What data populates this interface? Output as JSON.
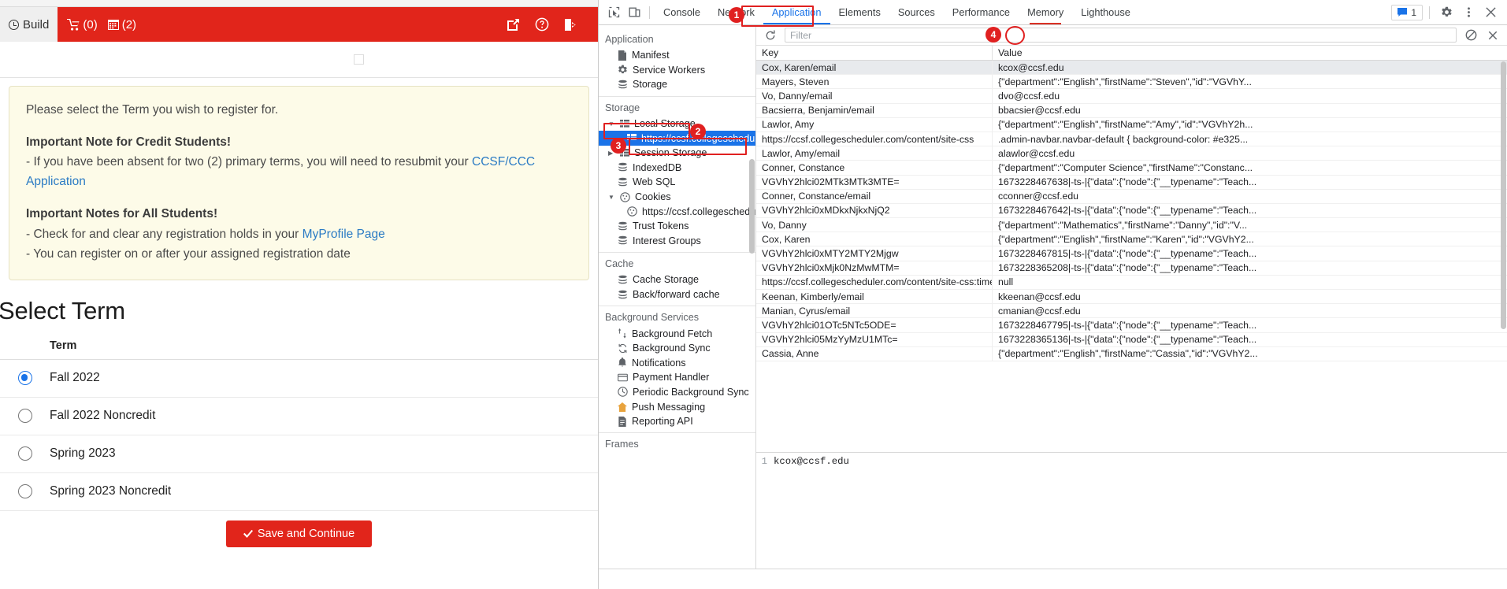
{
  "webpage": {
    "navbar": {
      "build_label": "Build",
      "cart_count": "(0)",
      "calendar_count": "(2)",
      "icons": [
        "external-link-icon",
        "help-icon",
        "logout-icon"
      ]
    },
    "notice": {
      "line1": "Please select the Term you wish to register for.",
      "heading1": "Important Note for Credit Students!",
      "line2_pre": "- If you have been absent for two (2) primary terms, you will need to resubmit your ",
      "line2_link": "CCSF/CCC Application",
      "heading2": "Important Notes for All Students!",
      "line3_pre": "- Check for and clear any registration holds in your ",
      "line3_link": "MyProfile Page",
      "line4": "- You can register on or after your assigned registration date"
    },
    "select_term": {
      "title": "Select Term",
      "column_header": "Term",
      "options": [
        {
          "label": "Fall 2022",
          "selected": true
        },
        {
          "label": "Fall 2022 Noncredit",
          "selected": false
        },
        {
          "label": "Spring 2023",
          "selected": false
        },
        {
          "label": "Spring 2023 Noncredit",
          "selected": false
        }
      ],
      "save_button": "Save and Continue"
    }
  },
  "devtools": {
    "tabs": [
      {
        "label": "Console",
        "active": false
      },
      {
        "label": "Network",
        "active": false
      },
      {
        "label": "Application",
        "active": true
      },
      {
        "label": "Elements",
        "active": false
      },
      {
        "label": "Sources",
        "active": false
      },
      {
        "label": "Performance",
        "active": false
      },
      {
        "label": "Memory",
        "active": false
      },
      {
        "label": "Lighthouse",
        "active": false
      }
    ],
    "message_count": "1",
    "sidebar": {
      "application_section": "Application",
      "application_items": [
        {
          "label": "Manifest",
          "icon": "manifest-icon"
        },
        {
          "label": "Service Workers",
          "icon": "gear-icon"
        },
        {
          "label": "Storage",
          "icon": "database-icon"
        }
      ],
      "storage_section": "Storage",
      "storage_items": [
        {
          "label": "Local Storage",
          "icon": "table-icon",
          "level": 1,
          "expanded": true
        },
        {
          "label": "https://ccsf.collegescheduler",
          "icon": "table-icon",
          "level": 2,
          "selected": true
        },
        {
          "label": "Session Storage",
          "icon": "table-icon",
          "level": 1,
          "expanded": false
        },
        {
          "label": "IndexedDB",
          "icon": "database-icon",
          "level": 1
        },
        {
          "label": "Web SQL",
          "icon": "database-icon",
          "level": 1
        },
        {
          "label": "Cookies",
          "icon": "cookie-icon",
          "level": 1,
          "expanded": true
        },
        {
          "label": "https://ccsf.collegescheduler",
          "icon": "cookie-icon",
          "level": 2
        },
        {
          "label": "Trust Tokens",
          "icon": "database-icon",
          "level": 1
        },
        {
          "label": "Interest Groups",
          "icon": "database-icon",
          "level": 1
        }
      ],
      "cache_section": "Cache",
      "cache_items": [
        {
          "label": "Cache Storage",
          "icon": "database-icon"
        },
        {
          "label": "Back/forward cache",
          "icon": "database-icon"
        }
      ],
      "background_section": "Background Services",
      "background_items": [
        {
          "label": "Background Fetch",
          "icon": "fetch-icon"
        },
        {
          "label": "Background Sync",
          "icon": "sync-icon"
        },
        {
          "label": "Notifications",
          "icon": "bell-icon"
        },
        {
          "label": "Payment Handler",
          "icon": "payment-icon"
        },
        {
          "label": "Periodic Background Sync",
          "icon": "clock-icon"
        },
        {
          "label": "Push Messaging",
          "icon": "push-icon"
        },
        {
          "label": "Reporting API",
          "icon": "report-icon"
        }
      ],
      "frames_section": "Frames"
    },
    "toolbar": {
      "refresh_icon": "refresh-icon",
      "filter_placeholder": "Filter",
      "clear_icon": "no-entry-icon",
      "close_icon": "close-icon"
    },
    "table": {
      "columns": [
        "Key",
        "Value"
      ],
      "rows": [
        {
          "key": "Cox, Karen/email",
          "value": "kcox@ccsf.edu",
          "selected": true
        },
        {
          "key": "Mayers, Steven",
          "value": "{\"department\":\"English\",\"firstName\":\"Steven\",\"id\":\"VGVhY..."
        },
        {
          "key": "Vo, Danny/email",
          "value": "dvo@ccsf.edu"
        },
        {
          "key": "Bacsierra, Benjamin/email",
          "value": "bbacsier@ccsf.edu"
        },
        {
          "key": "Lawlor, Amy",
          "value": "{\"department\":\"English\",\"firstName\":\"Amy\",\"id\":\"VGVhY2h..."
        },
        {
          "key": "https://ccsf.collegescheduler.com/content/site-css",
          "value": ".admin-navbar.navbar-default { background-color: #e325..."
        },
        {
          "key": "Lawlor, Amy/email",
          "value": "alawlor@ccsf.edu"
        },
        {
          "key": "Conner, Constance",
          "value": "{\"department\":\"Computer Science\",\"firstName\":\"Constanc..."
        },
        {
          "key": "VGVhY2hlci02MTk3MTk3MTE=",
          "value": "1673228467638|-ts-|{\"data\":{\"node\":{\"__typename\":\"Teach..."
        },
        {
          "key": "Conner, Constance/email",
          "value": "cconner@ccsf.edu"
        },
        {
          "key": "VGVhY2hlci0xMDkxNjkxNjQ2",
          "value": "1673228467642|-ts-|{\"data\":{\"node\":{\"__typename\":\"Teach..."
        },
        {
          "key": "Vo, Danny",
          "value": "{\"department\":\"Mathematics\",\"firstName\":\"Danny\",\"id\":\"V..."
        },
        {
          "key": "Cox, Karen",
          "value": "{\"department\":\"English\",\"firstName\":\"Karen\",\"id\":\"VGVhY2..."
        },
        {
          "key": "VGVhY2hlci0xMTY2MTY2Mjgw",
          "value": "1673228467815|-ts-|{\"data\":{\"node\":{\"__typename\":\"Teach..."
        },
        {
          "key": "VGVhY2hlci0xMjk0NzMwMTM=",
          "value": "1673228365208|-ts-|{\"data\":{\"node\":{\"__typename\":\"Teach..."
        },
        {
          "key": "https://ccsf.collegescheduler.com/content/site-css:timest...",
          "value": "null"
        },
        {
          "key": "Keenan, Kimberly/email",
          "value": "kkeenan@ccsf.edu"
        },
        {
          "key": "Manian, Cyrus/email",
          "value": "cmanian@ccsf.edu"
        },
        {
          "key": "VGVhY2hlci01OTc5NTc5ODE=",
          "value": "1673228467795|-ts-|{\"data\":{\"node\":{\"__typename\":\"Teach..."
        },
        {
          "key": "VGVhY2hlci05MzYyMzU1MTc=",
          "value": "1673228365136|-ts-|{\"data\":{\"node\":{\"__typename\":\"Teach..."
        },
        {
          "key": "Cassia, Anne",
          "value": "{\"department\":\"English\",\"firstName\":\"Cassia\",\"id\":\"VGVhY2..."
        }
      ]
    },
    "preview": {
      "line_number": "1",
      "content": "kcox@ccsf.edu"
    }
  },
  "annotations": [
    {
      "n": "1",
      "target": "network-tab"
    },
    {
      "n": "2",
      "target": "local-storage-item"
    },
    {
      "n": "3",
      "target": "origin-item"
    },
    {
      "n": "4",
      "target": "clear-button"
    }
  ],
  "colors": {
    "brand_red": "#e1251b",
    "annotation_red": "#e02020",
    "devtools_blue": "#1a73e8",
    "notice_bg": "#fdfbe8"
  }
}
